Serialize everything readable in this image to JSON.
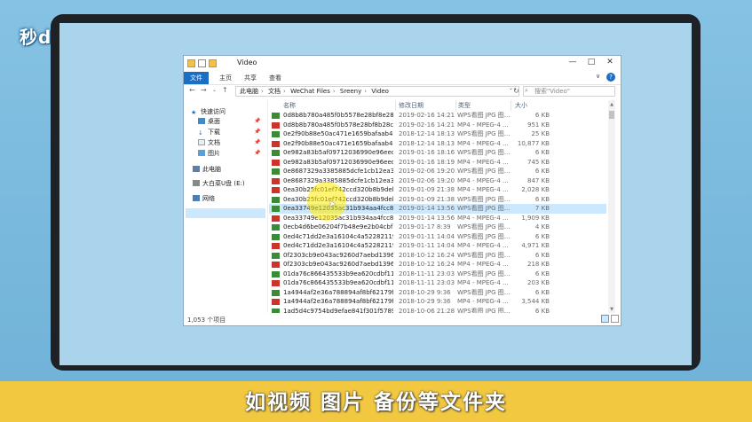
{
  "logo": "秒dong视频",
  "caption": "如视频 图片 备份等文件夹",
  "window": {
    "title": "Video",
    "ribbon_tabs": [
      "文件",
      "主页",
      "共享",
      "查看"
    ],
    "path": [
      "此电脑",
      "文档",
      "WeChat Files",
      "Sreeny",
      "Video"
    ],
    "search_placeholder": "搜索\"Video\"",
    "status": "1,053 个项目",
    "controls": {
      "minimize": "—",
      "maximize": "□",
      "close": "✕"
    },
    "nav": {
      "back": "←",
      "forward": "→",
      "dropdown": "⌄",
      "up": "↑",
      "refresh": "↻",
      "chevron": "∨",
      "help": "?"
    }
  },
  "sidebar": {
    "items": [
      {
        "label": "快速访问",
        "icon": "star-icon",
        "pinned": false
      },
      {
        "label": "桌面",
        "icon": "desktop-icon",
        "pinned": true
      },
      {
        "label": "下载",
        "icon": "download-icon",
        "pinned": true
      },
      {
        "label": "文档",
        "icon": "document-icon",
        "pinned": true
      },
      {
        "label": "图片",
        "icon": "picture-icon",
        "pinned": true
      },
      {
        "label": "此电脑",
        "icon": "computer-icon",
        "pinned": false
      },
      {
        "label": "大白菜U盘 (E:)",
        "icon": "usb-drive-icon",
        "pinned": false
      },
      {
        "label": "网络",
        "icon": "network-icon",
        "pinned": false
      }
    ]
  },
  "columns": [
    "名称",
    "修改日期",
    "类型",
    "大小"
  ],
  "files": [
    {
      "name": "0d8b8b780a485f0b5578e28bf8e28cec...",
      "date": "2019-02-16 14:21",
      "type": "WPS看图 JPG 图...",
      "size": "6 KB",
      "icon": "jpg"
    },
    {
      "name": "0d8b8b780a485f0b578e28bf8b28ce...",
      "date": "2019-02-16 14:21",
      "type": "MP4 - MPEG-4 ...",
      "size": "951 KB",
      "icon": "mp4"
    },
    {
      "name": "0e2f90b88e50ac471e1659bafaab495...",
      "date": "2018-12-14 18:13",
      "type": "WPS看图 JPG 图...",
      "size": "25 KB",
      "icon": "jpg"
    },
    {
      "name": "0e2f90b88e50ac471e1659bafaab495...",
      "date": "2018-12-14 18:13",
      "type": "MP4 - MPEG-4 ...",
      "size": "10,877 KB",
      "icon": "mp4"
    },
    {
      "name": "0e982a83b5af09712036990e96eeda...",
      "date": "2019-01-16 18:16",
      "type": "WPS看图 JPG 图...",
      "size": "6 KB",
      "icon": "jpg"
    },
    {
      "name": "0e982a83b5af09712036990e96eeda...",
      "date": "2019-01-16 18:19",
      "type": "MP4 - MPEG-4 ...",
      "size": "745 KB",
      "icon": "mp4"
    },
    {
      "name": "0e8687329a3385885dcfe1cb12ea351...",
      "date": "2019-02-06 19:20",
      "type": "WPS看图 JPG 图...",
      "size": "6 KB",
      "icon": "jpg"
    },
    {
      "name": "0e8687329a3385885dcfe1cb12ea351...",
      "date": "2019-02-06 19:20",
      "type": "MP4 - MPEG-4 ...",
      "size": "847 KB",
      "icon": "mp4"
    },
    {
      "name": "0ea30b25fc01ef742ccd320b8b9debb...",
      "date": "2019-01-09 21:38",
      "type": "MP4 - MPEG-4 ...",
      "size": "2,028 KB",
      "icon": "mp4"
    },
    {
      "name": "0ea30b25fc01ef742ccd320b8b9debb...",
      "date": "2019-01-09 21:38",
      "type": "WPS看图 JPG 图...",
      "size": "6 KB",
      "icon": "jpg"
    },
    {
      "name": "0ea33749e12035ac31b934aa4fcc8e6...",
      "date": "2019-01-14 13:56",
      "type": "WPS看图 JPG 图...",
      "size": "7 KB",
      "icon": "jpg",
      "selected": true
    },
    {
      "name": "0ea33749e12035ac31b934aa4fcc8e6...",
      "date": "2019-01-14 13:56",
      "type": "MP4 - MPEG-4 ...",
      "size": "1,909 KB",
      "icon": "mp4"
    },
    {
      "name": "0ecb4d6be06204f7b48e9e2b04cbf86...",
      "date": "2019-01-17 8:39",
      "type": "WPS看图 JPG 图...",
      "size": "4 KB",
      "icon": "jpg"
    },
    {
      "name": "0ed4c71dd2e3a16104c4a52282119fa...",
      "date": "2019-01-11 14:04",
      "type": "WPS看图 JPG 图...",
      "size": "6 KB",
      "icon": "jpg"
    },
    {
      "name": "0ed4c71dd2e3a16104c4a52282119fa...",
      "date": "2019-01-11 14:04",
      "type": "MP4 - MPEG-4 ...",
      "size": "4,971 KB",
      "icon": "mp4"
    },
    {
      "name": "0f2303cb9e043ac9260d7aebd1396ad...",
      "date": "2018-10-12 16:24",
      "type": "WPS看图 JPG 图...",
      "size": "6 KB",
      "icon": "jpg"
    },
    {
      "name": "0f2303cb9e043ac9260d7aebd1396ad...",
      "date": "2018-10-12 16:24",
      "type": "MP4 - MPEG-4 ...",
      "size": "218 KB",
      "icon": "mp4"
    },
    {
      "name": "01da76c866435533b9ea620cdbf11a...",
      "date": "2018-11-11 23:03",
      "type": "WPS看图 JPG 图...",
      "size": "6 KB",
      "icon": "jpg"
    },
    {
      "name": "01da76c866435533b9ea620cdbf11a...",
      "date": "2018-11-11 23:03",
      "type": "MP4 - MPEG-4 ...",
      "size": "203 KB",
      "icon": "mp4"
    },
    {
      "name": "1a4944af2e36a788894af8bf62179fa1...",
      "date": "2018-10-29 9:36",
      "type": "WPS看图 JPG 图...",
      "size": "6 KB",
      "icon": "jpg"
    },
    {
      "name": "1a4944af2e36a788894af8bf62179fa1...",
      "date": "2018-10-29 9:36",
      "type": "MP4 - MPEG-4 ...",
      "size": "3,544 KB",
      "icon": "mp4"
    },
    {
      "name": "1ad5d4c9754bd9efae841f301f57898...",
      "date": "2018-10-06 21:28",
      "type": "WPS看图 JPG 图...",
      "size": "6 KB",
      "icon": "jpg"
    }
  ],
  "colors": {
    "accent": "#1a6fc4",
    "selection": "#cce8ff",
    "highlight": "#f2c840"
  }
}
